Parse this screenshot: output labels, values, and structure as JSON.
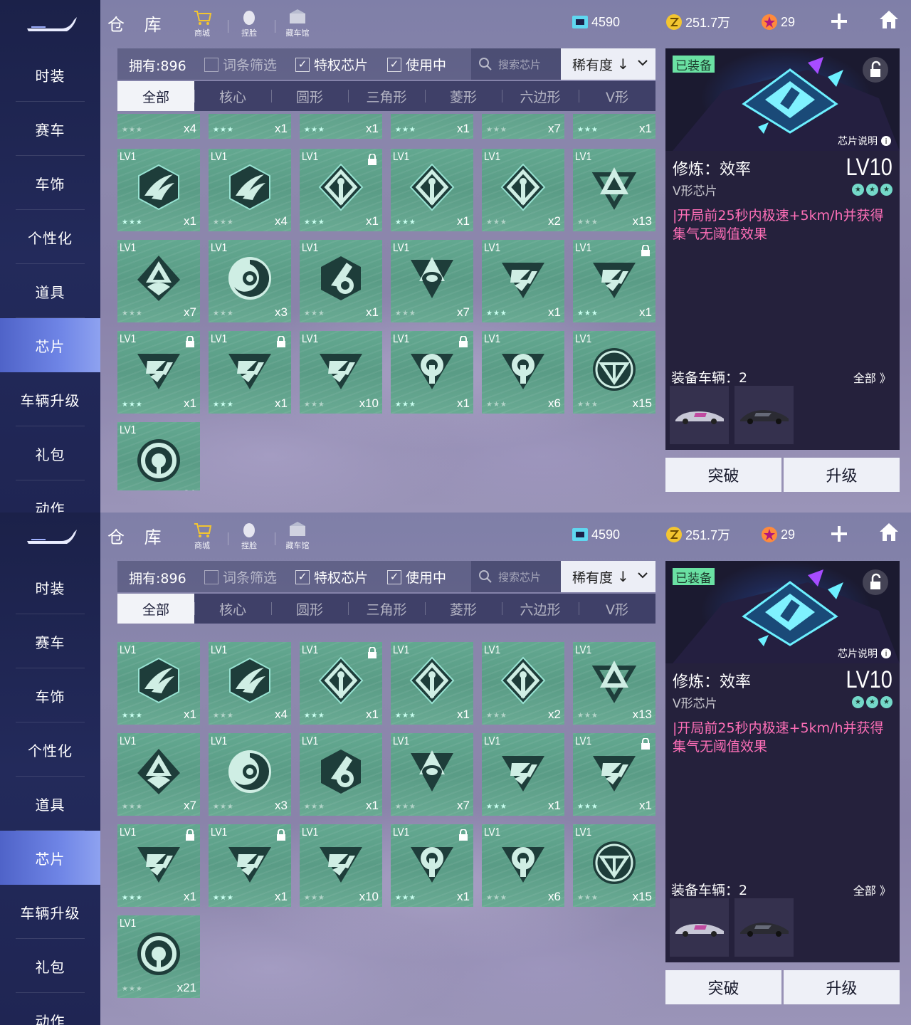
{
  "sidebar": {
    "items": [
      {
        "label": "时装"
      },
      {
        "label": "赛车"
      },
      {
        "label": "车饰"
      },
      {
        "label": "个性化"
      },
      {
        "label": "道具"
      },
      {
        "label": "芯片",
        "active": true
      },
      {
        "label": "车辆升级"
      },
      {
        "label": "礼包"
      },
      {
        "label": "动作"
      }
    ]
  },
  "header": {
    "title": "仓 库",
    "shortcuts": [
      {
        "label": "商城",
        "icon": "shop-cart-icon"
      },
      {
        "label": "捏脸",
        "icon": "face-edit-icon"
      },
      {
        "label": "藏车馆",
        "icon": "garage-icon"
      }
    ],
    "currencies": [
      {
        "icon": "ticket-icon",
        "value": "4590",
        "color": "#5fd7f0"
      },
      {
        "icon": "coin-icon",
        "value": "251.7万",
        "color": "#f3c530"
      },
      {
        "icon": "star-medal-icon",
        "value": "29",
        "color": "#ff8a3c"
      }
    ]
  },
  "filter": {
    "owned": "拥有:896",
    "checkboxes": [
      {
        "label": "词条筛选",
        "checked": false
      },
      {
        "label": "特权芯片",
        "checked": true
      },
      {
        "label": "使用中",
        "checked": true
      }
    ],
    "search_placeholder": "搜索芯片",
    "sort_label": "稀有度",
    "sort_direction": "↓"
  },
  "tabs": [
    "全部",
    "核心",
    "圆形",
    "三角形",
    "菱形",
    "六边形",
    "V形"
  ],
  "top_partial_row": [
    {
      "count": "x4",
      "stars": "gray"
    },
    {
      "count": "x1",
      "stars": "bright"
    },
    {
      "count": "x1",
      "stars": "bright"
    },
    {
      "count": "x1",
      "stars": "bright"
    },
    {
      "count": "x7",
      "stars": "gray"
    },
    {
      "count": "x1",
      "stars": "bright"
    }
  ],
  "chips": [
    {
      "level": "LV1",
      "count": "x1",
      "stars": "bright",
      "locked": false,
      "emblem": "hex-wing"
    },
    {
      "level": "LV1",
      "count": "x4",
      "stars": "gray",
      "locked": false,
      "emblem": "hex-wing"
    },
    {
      "level": "LV1",
      "count": "x1",
      "stars": "bright",
      "locked": true,
      "emblem": "diamond-spire"
    },
    {
      "level": "LV1",
      "count": "x1",
      "stars": "bright",
      "locked": false,
      "emblem": "diamond-spire"
    },
    {
      "level": "LV1",
      "count": "x2",
      "stars": "gray",
      "locked": false,
      "emblem": "diamond-spire"
    },
    {
      "level": "LV1",
      "count": "x13",
      "stars": "gray",
      "locked": false,
      "emblem": "triangle-knot"
    },
    {
      "level": "LV1",
      "count": "x7",
      "stars": "gray",
      "locked": false,
      "emblem": "diamond-tri"
    },
    {
      "level": "LV1",
      "count": "x3",
      "stars": "gray",
      "locked": false,
      "emblem": "swirl"
    },
    {
      "level": "LV1",
      "count": "x1",
      "stars": "gray",
      "locked": false,
      "emblem": "hex-hook"
    },
    {
      "level": "LV1",
      "count": "x7",
      "stars": "gray",
      "locked": false,
      "emblem": "triangle-stone"
    },
    {
      "level": "LV1",
      "count": "x1",
      "stars": "bright",
      "locked": false,
      "emblem": "v-shape"
    },
    {
      "level": "LV1",
      "count": "x1",
      "stars": "bright",
      "locked": true,
      "emblem": "v-shape"
    },
    {
      "level": "LV1",
      "count": "x1",
      "stars": "bright",
      "locked": true,
      "emblem": "v-shape"
    },
    {
      "level": "LV1",
      "count": "x1",
      "stars": "bright",
      "locked": true,
      "emblem": "v-shape"
    },
    {
      "level": "LV1",
      "count": "x10",
      "stars": "gray",
      "locked": false,
      "emblem": "v-shape"
    },
    {
      "level": "LV1",
      "count": "x1",
      "stars": "bright",
      "locked": true,
      "emblem": "v-arch"
    },
    {
      "level": "LV1",
      "count": "x6",
      "stars": "gray",
      "locked": false,
      "emblem": "v-arch"
    },
    {
      "level": "LV1",
      "count": "x15",
      "stars": "gray",
      "locked": false,
      "emblem": "circle-tri"
    },
    {
      "level": "LV1",
      "count": "x21",
      "stars": "gray",
      "locked": false,
      "emblem": "circle-core"
    }
  ],
  "detail": {
    "equipped_badge": "已装备",
    "info_label": "芯片说明",
    "name": "修炼：效率",
    "type": "V形芯片",
    "level": "LV10",
    "description": "|开局前25秒内极速+5km/h并获得集气无阈值效果",
    "vehicles_label": "装备车辆：2",
    "vehicles_all": "全部 》",
    "vehicles": [
      {
        "icon": "race-car-silver-icon"
      },
      {
        "icon": "race-car-black-icon"
      }
    ]
  },
  "actions": {
    "breakthrough": "突破",
    "upgrade": "升级"
  }
}
